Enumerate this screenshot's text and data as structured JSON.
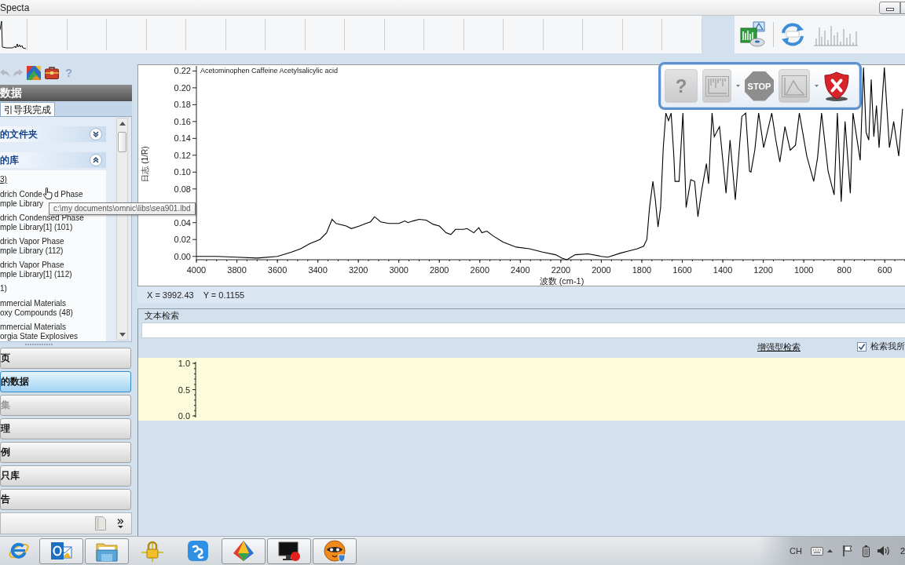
{
  "window": {
    "title": "Specta"
  },
  "thumbnails": [
    {
      "kind": "spectrum"
    },
    {
      "kind": "empty"
    },
    {
      "kind": "empty"
    },
    {
      "kind": "empty"
    },
    {
      "kind": "empty"
    },
    {
      "kind": "empty"
    },
    {
      "kind": "empty"
    },
    {
      "kind": "empty"
    },
    {
      "kind": "empty"
    },
    {
      "kind": "empty"
    },
    {
      "kind": "empty"
    },
    {
      "kind": "empty"
    },
    {
      "kind": "empty"
    },
    {
      "kind": "empty"
    },
    {
      "kind": "empty"
    },
    {
      "kind": "empty"
    },
    {
      "kind": "empty"
    },
    {
      "kind": "empty"
    }
  ],
  "sidebar": {
    "tools": [
      {
        "kind": "undo",
        "disabled": true
      },
      {
        "kind": "redo",
        "disabled": true
      },
      {
        "kind": "color-map",
        "disabled": false
      },
      {
        "kind": "toolbox",
        "disabled": false
      },
      {
        "kind": "help",
        "label": "?",
        "disabled": false
      }
    ],
    "header": "数据",
    "tabs": [
      {
        "label": "引导我完成",
        "selected": true
      }
    ],
    "sections": [
      {
        "title": "的文件夹",
        "expanded": false
      },
      {
        "title": "的库",
        "expanded": true,
        "items": [
          {
            "kind": "link",
            "text": "3)"
          },
          {
            "kind": "entry",
            "pointer": true,
            "lines": [
              [
                "drich Conde",
                "d Phase"
              ],
              [
                "mple Library"
              ]
            ]
          },
          {
            "kind": "entry",
            "pointer": false,
            "lines": [
              [
                "drich Condensed Phase"
              ],
              [
                "mple Library[1] (101)"
              ]
            ]
          },
          {
            "kind": "entry",
            "pointer": false,
            "lines": [
              [
                "drich Vapor Phase"
              ],
              [
                "mple Library (112)"
              ]
            ]
          },
          {
            "kind": "entry",
            "pointer": false,
            "lines": [
              [
                "drich Vapor Phase"
              ],
              [
                "mple Library[1] (112)"
              ]
            ]
          },
          {
            "kind": "group",
            "text": "1)"
          },
          {
            "kind": "entry",
            "pointer": false,
            "lines": [
              [
                "mmercial Materials"
              ],
              [
                "oxy Compounds (48)"
              ]
            ]
          },
          {
            "kind": "entry",
            "pointer": false,
            "lines": [
              [
                "mmercial Materials"
              ],
              [
                "orgia State Explosives"
              ]
            ]
          }
        ]
      }
    ],
    "nav": [
      {
        "label": "页",
        "selected": false,
        "disabled": false
      },
      {
        "label": "的数据",
        "selected": true,
        "disabled": false
      },
      {
        "label": "集",
        "selected": false,
        "disabled": true
      },
      {
        "label": "理",
        "selected": false,
        "disabled": false
      },
      {
        "label": "例",
        "selected": false,
        "disabled": false
      },
      {
        "label": "只库",
        "selected": false,
        "disabled": false
      },
      {
        "label": "告",
        "selected": false,
        "disabled": false
      }
    ]
  },
  "tooltip": "c:\\my documents\\omnic\\libs\\sea901.lbd",
  "chart_panel": {
    "chart_data": {
      "type": "line",
      "title": "Acetominophen Caffeine Acetylsalicylic acid",
      "xlabel": "波数 (cm-1)",
      "ylabel": "日志 (1/R)",
      "x": [
        4000,
        3900,
        3800,
        3700,
        3600,
        3530,
        3485,
        3440,
        3390,
        3357,
        3330,
        3310,
        3260,
        3235,
        3195,
        3163,
        3140,
        3120,
        3090,
        3050,
        3000,
        2970,
        2955,
        2930,
        2900,
        2865,
        2830,
        2800,
        2767,
        2743,
        2720,
        2680,
        2663,
        2630,
        2605,
        2590,
        2565,
        2533,
        2485,
        2420,
        2355,
        2290,
        2226,
        2194,
        2170,
        2129,
        2065,
        2000,
        1968,
        1903,
        1871,
        1822,
        1791,
        1775,
        1762,
        1745,
        1733,
        1720,
        1707,
        1694,
        1681,
        1668,
        1655,
        1642,
        1636,
        1616,
        1597,
        1581,
        1558,
        1539,
        1523,
        1504,
        1481,
        1470,
        1453,
        1442,
        1416,
        1384,
        1364,
        1338,
        1306,
        1287,
        1268,
        1261,
        1242,
        1223,
        1198,
        1158,
        1138,
        1118,
        1093,
        1067,
        1041,
        1022,
        985,
        951,
        932,
        912,
        880,
        850,
        834,
        815,
        796,
        770,
        757,
        721,
        705,
        692,
        679,
        667,
        654,
        641,
        628,
        602,
        577,
        556,
        531,
        512
      ],
      "values": [
        0,
        0,
        -0.001,
        -0.002,
        0,
        0.005,
        0.009,
        0.015,
        0.02,
        0.028,
        0.044,
        0.039,
        0.036,
        0.033,
        0.036,
        0.039,
        0.041,
        0.047,
        0.041,
        0.039,
        0.039,
        0.042,
        0.04,
        0.042,
        0.044,
        0.043,
        0.038,
        0.036,
        0.028,
        0.026,
        0.032,
        0.032,
        0.033,
        0.028,
        0.034,
        0.028,
        0.03,
        0.024,
        0.017,
        0.011,
        0.009,
        0.005,
        0.002,
        -0.002,
        -0.004,
        0.002,
        0.003,
        0,
        -0.001,
        0.004,
        0.006,
        0.009,
        0.012,
        0.02,
        0.058,
        0.089,
        0.067,
        0.035,
        0.058,
        0.129,
        0.17,
        0.161,
        0.17,
        0.12,
        0.089,
        0.089,
        0.17,
        0.058,
        0.091,
        0.089,
        0.047,
        0.079,
        0.11,
        0.086,
        0.17,
        0.142,
        0.154,
        0.075,
        0.138,
        0.067,
        0.166,
        0.17,
        0.101,
        0.1,
        0.126,
        0.17,
        0.129,
        0.17,
        0.138,
        0.112,
        0.154,
        0.126,
        0.132,
        0.17,
        0.119,
        0.089,
        0.117,
        0.17,
        0.101,
        0.073,
        0.17,
        0.065,
        0.16,
        0.075,
        0.17,
        0.114,
        0.224,
        0.147,
        0.138,
        0.21,
        0.142,
        0.179,
        0.129,
        0.224,
        0.129,
        0.16,
        0.119,
        0.175
      ],
      "xlim": [
        4000,
        500
      ],
      "ylim": [
        -0.004,
        0.226
      ],
      "xticks": [
        4000,
        3800,
        3600,
        3400,
        3200,
        3000,
        2800,
        2600,
        2400,
        2200,
        2000,
        1800,
        1600,
        1400,
        1200,
        1000,
        800,
        600
      ],
      "yticks": [
        {
          "value": 0,
          "label": "0.00"
        },
        {
          "value": 0.02,
          "label": "0.02"
        },
        {
          "value": 0.04,
          "label": "0.04"
        },
        {
          "value": 0.08,
          "label": "0.08"
        },
        {
          "value": 0.1,
          "label": "0.10"
        },
        {
          "value": 0.12,
          "label": "0.12"
        },
        {
          "value": 0.14,
          "label": "0.14"
        },
        {
          "value": 0.16,
          "label": "0.16"
        },
        {
          "value": 0.18,
          "label": "0.18"
        },
        {
          "value": 0.2,
          "label": "0.20"
        },
        {
          "value": 0.22,
          "label": "0.22"
        }
      ]
    },
    "cursor_readout": {
      "x": "X = 3992.43",
      "y": "Y = 0.1155"
    }
  },
  "floating_toolbar": {
    "buttons": [
      {
        "kind": "help",
        "label": "?",
        "disabled": true
      },
      {
        "kind": "display",
        "disabled": true,
        "dropdown": true
      },
      {
        "kind": "stop",
        "label": "STOP",
        "disabled": true
      },
      {
        "kind": "peak",
        "disabled": true,
        "dropdown": true
      },
      {
        "kind": "close",
        "disabled": false
      }
    ]
  },
  "search_panel": {
    "title": "文本检索",
    "advanced_link": "增强型检索",
    "search_mine": {
      "label": "检索我所",
      "checked": true
    }
  },
  "match_plot": {
    "yticks": [
      "1.0",
      "0.5",
      "0.0"
    ]
  },
  "taskbar": {
    "apps": [
      {
        "kind": "browser",
        "open": false
      },
      {
        "kind": "mail",
        "open": true
      },
      {
        "kind": "folder",
        "open": true
      },
      {
        "kind": "padlock",
        "open": false
      },
      {
        "kind": "app-tile",
        "open": false
      },
      {
        "kind": "pyramid",
        "open": true
      },
      {
        "kind": "monitor",
        "open": true
      },
      {
        "kind": "mask-face",
        "open": true
      }
    ],
    "tray": {
      "language": "CH",
      "clock": "2"
    }
  }
}
